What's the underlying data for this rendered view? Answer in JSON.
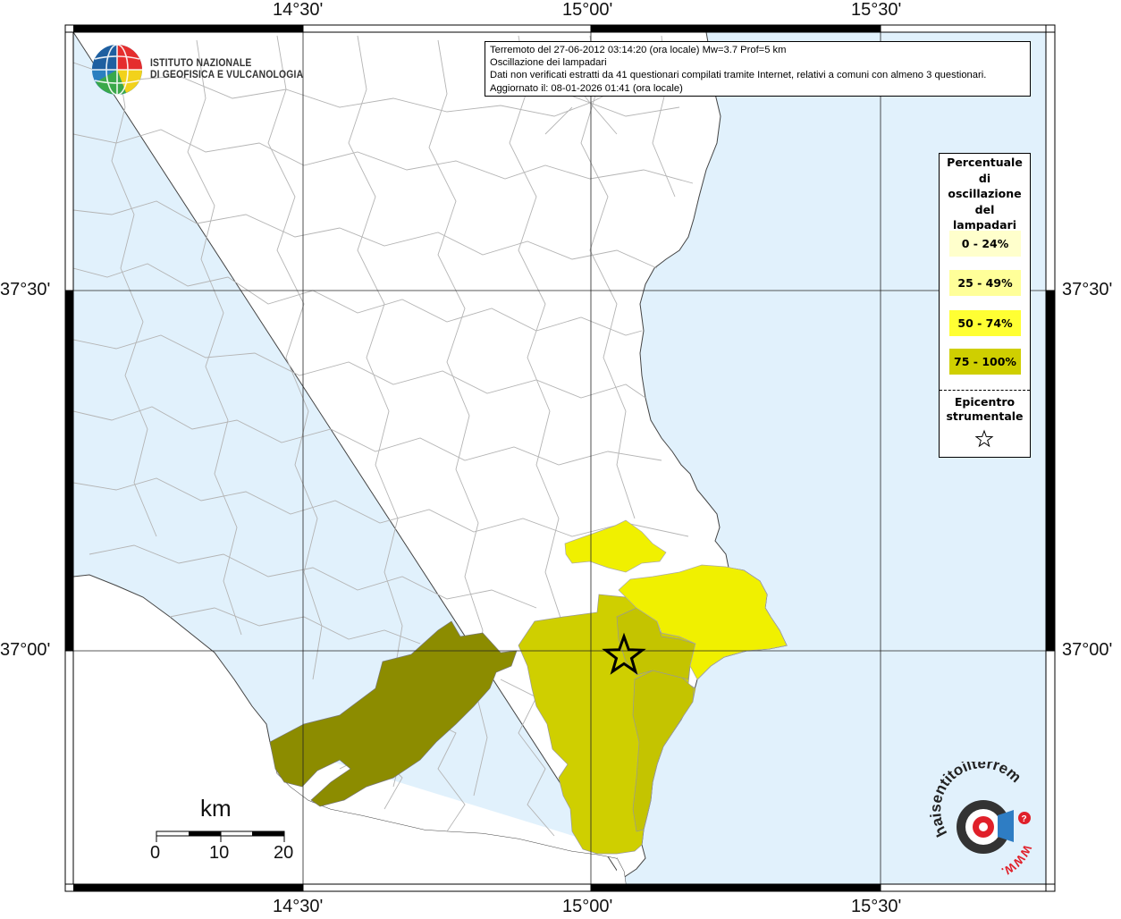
{
  "map": {
    "title_lines": [
      "Terremoto del 27-06-2012 03:14:20 (ora locale) Mw=3.7 Prof=5 km",
      "Oscillazione dei lampadari",
      "Dati non verificati estratti da 41 questionari compilati tramite Internet, relativi a comuni con almeno 3 questionari.",
      "Aggiornato il: 08-01-2026 01:41 (ora locale)"
    ],
    "lon_labels": [
      "14°30'",
      "15°00'",
      "15°30'"
    ],
    "lat_labels": [
      "37°30'",
      "37°00'"
    ],
    "colors": {
      "land": "#ffffff",
      "sea": "#e1f1fc",
      "border": "#aaaaaa",
      "class_0_24": "#ffffcc",
      "class_25_49": "#ffff99",
      "class_50_74": "#f0f000",
      "class_75_100": "#8c8c00",
      "class_mid": "#cfcf00"
    }
  },
  "institute": {
    "line1": "ISTITUTO NAZIONALE",
    "line2": "DI GEOFISICA E VULCANOLOGIA"
  },
  "legend": {
    "title": "Percentuale di oscillazione dei lampadari",
    "title_lines": [
      "Percentuale",
      "di",
      "oscillazione",
      "del",
      "lampadari"
    ],
    "classes": [
      {
        "label": "0 - 24%",
        "color": "#ffffcc"
      },
      {
        "label": "25 - 49%",
        "color": "#ffff99"
      },
      {
        "label": "50 - 74%",
        "color": "#ffff33"
      },
      {
        "label": "75 - 100%",
        "color": "#cfcf00"
      }
    ],
    "epicenter_lines": [
      "Epicentro",
      "strumentale"
    ],
    "epicenter_symbol": "star-icon"
  },
  "scale_bar": {
    "unit": "km",
    "ticks": [
      "0",
      "10",
      "20"
    ]
  },
  "hst_logo": {
    "text": "haisentitoilterremoto.it",
    "www": "WWW.",
    "question": "?"
  }
}
